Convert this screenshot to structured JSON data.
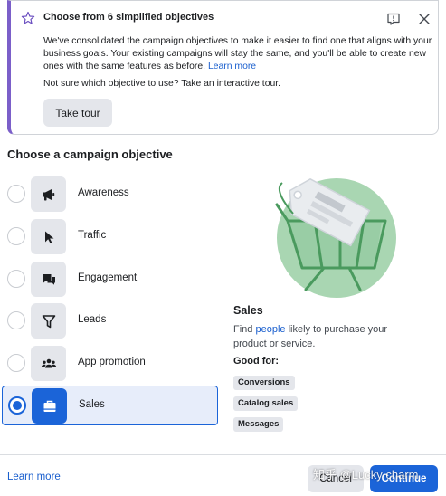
{
  "banner": {
    "title": "Choose from 6 simplified objectives",
    "body": "We've consolidated the campaign objectives to make it easier to find one that aligns with your business goals. Your existing campaigns will stay the same, and you'll be able to create new ones with the same features as before.",
    "learn_more_link": "Learn more",
    "tour_question": "Not sure which objective to use? Take an interactive tour.",
    "tour_button": "Take tour",
    "accent_color": "#7b5fc9"
  },
  "section_title": "Choose a campaign objective",
  "objectives": [
    {
      "label": "Awareness",
      "icon": "megaphone-icon",
      "selected": false
    },
    {
      "label": "Traffic",
      "icon": "cursor-icon",
      "selected": false
    },
    {
      "label": "Engagement",
      "icon": "chat-bubbles-icon",
      "selected": false
    },
    {
      "label": "Leads",
      "icon": "funnel-icon",
      "selected": false
    },
    {
      "label": "App promotion",
      "icon": "people-icon",
      "selected": false
    },
    {
      "label": "Sales",
      "icon": "briefcase-icon",
      "selected": true
    }
  ],
  "detail": {
    "title": "Sales",
    "desc_before": "Find ",
    "desc_link": "people",
    "desc_after": " likely to purchase your product or service.",
    "good_for_label": "Good for:",
    "chips": [
      "Conversions",
      "Catalog sales",
      "Messages"
    ],
    "illustration": "shopping-cart-with-price-tag"
  },
  "footer": {
    "learn_more": "Learn more",
    "cancel": "Cancel",
    "continue": "Continue"
  },
  "watermark": "知乎 @Lucky charm",
  "colors": {
    "primary": "#1b64d8",
    "selected_bg": "#e7edfa",
    "illustration_green": "#8cc69a"
  }
}
